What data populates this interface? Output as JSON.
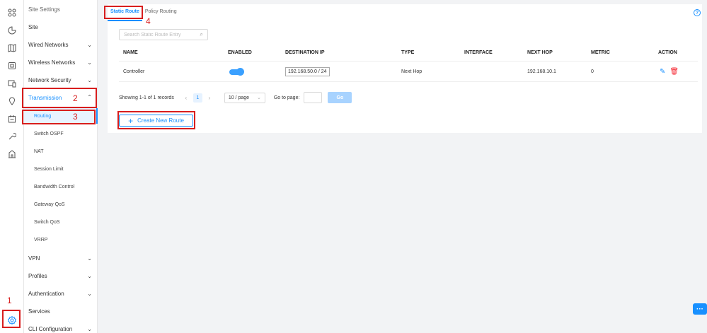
{
  "sidebar": {
    "items": [
      {
        "label": "Site Settings"
      },
      {
        "label": "Site"
      },
      {
        "label": "Wired Networks"
      },
      {
        "label": "Wireless Networks"
      },
      {
        "label": "Network Security"
      },
      {
        "label": "Transmission"
      },
      {
        "label": "Routing"
      },
      {
        "label": "Switch OSPF"
      },
      {
        "label": "NAT"
      },
      {
        "label": "Session Limit"
      },
      {
        "label": "Bandwidth Control"
      },
      {
        "label": "Gateway QoS"
      },
      {
        "label": "Switch QoS"
      },
      {
        "label": "VRRP"
      },
      {
        "label": "VPN"
      },
      {
        "label": "Profiles"
      },
      {
        "label": "Authentication"
      },
      {
        "label": "Services"
      },
      {
        "label": "CLI Configuration"
      }
    ]
  },
  "tabs": [
    {
      "label": "Static Route"
    },
    {
      "label": "Policy Routing"
    }
  ],
  "help_glyph": "?",
  "search": {
    "placeholder": "Search Static Route Entry"
  },
  "table": {
    "headers": {
      "name": "NAME",
      "enabled": "ENABLED",
      "destination": "DESTINATION IP",
      "type": "TYPE",
      "interface": "INTERFACE",
      "next_hop": "NEXT HOP",
      "metric": "METRIC",
      "action": "ACTION"
    },
    "rows": [
      {
        "name": "Controller",
        "enabled": true,
        "destination": "192.168.50.0 / 24",
        "type": "Next Hop",
        "interface": "",
        "next_hop": "192.168.10.1",
        "metric": "0"
      }
    ]
  },
  "pagination": {
    "summary": "Showing 1-1 of 1 records",
    "current_page": "1",
    "page_size": "10 / page",
    "goto_label": "Go to page:",
    "go_label": "Go"
  },
  "create_button": {
    "label": "Create New Route"
  },
  "annotations": [
    {
      "label": "1"
    },
    {
      "label": "2"
    },
    {
      "label": "3"
    },
    {
      "label": "4"
    }
  ],
  "colors": {
    "accent": "#1890ff",
    "highlight": "#d81e1e",
    "delete": "#f5222d"
  }
}
